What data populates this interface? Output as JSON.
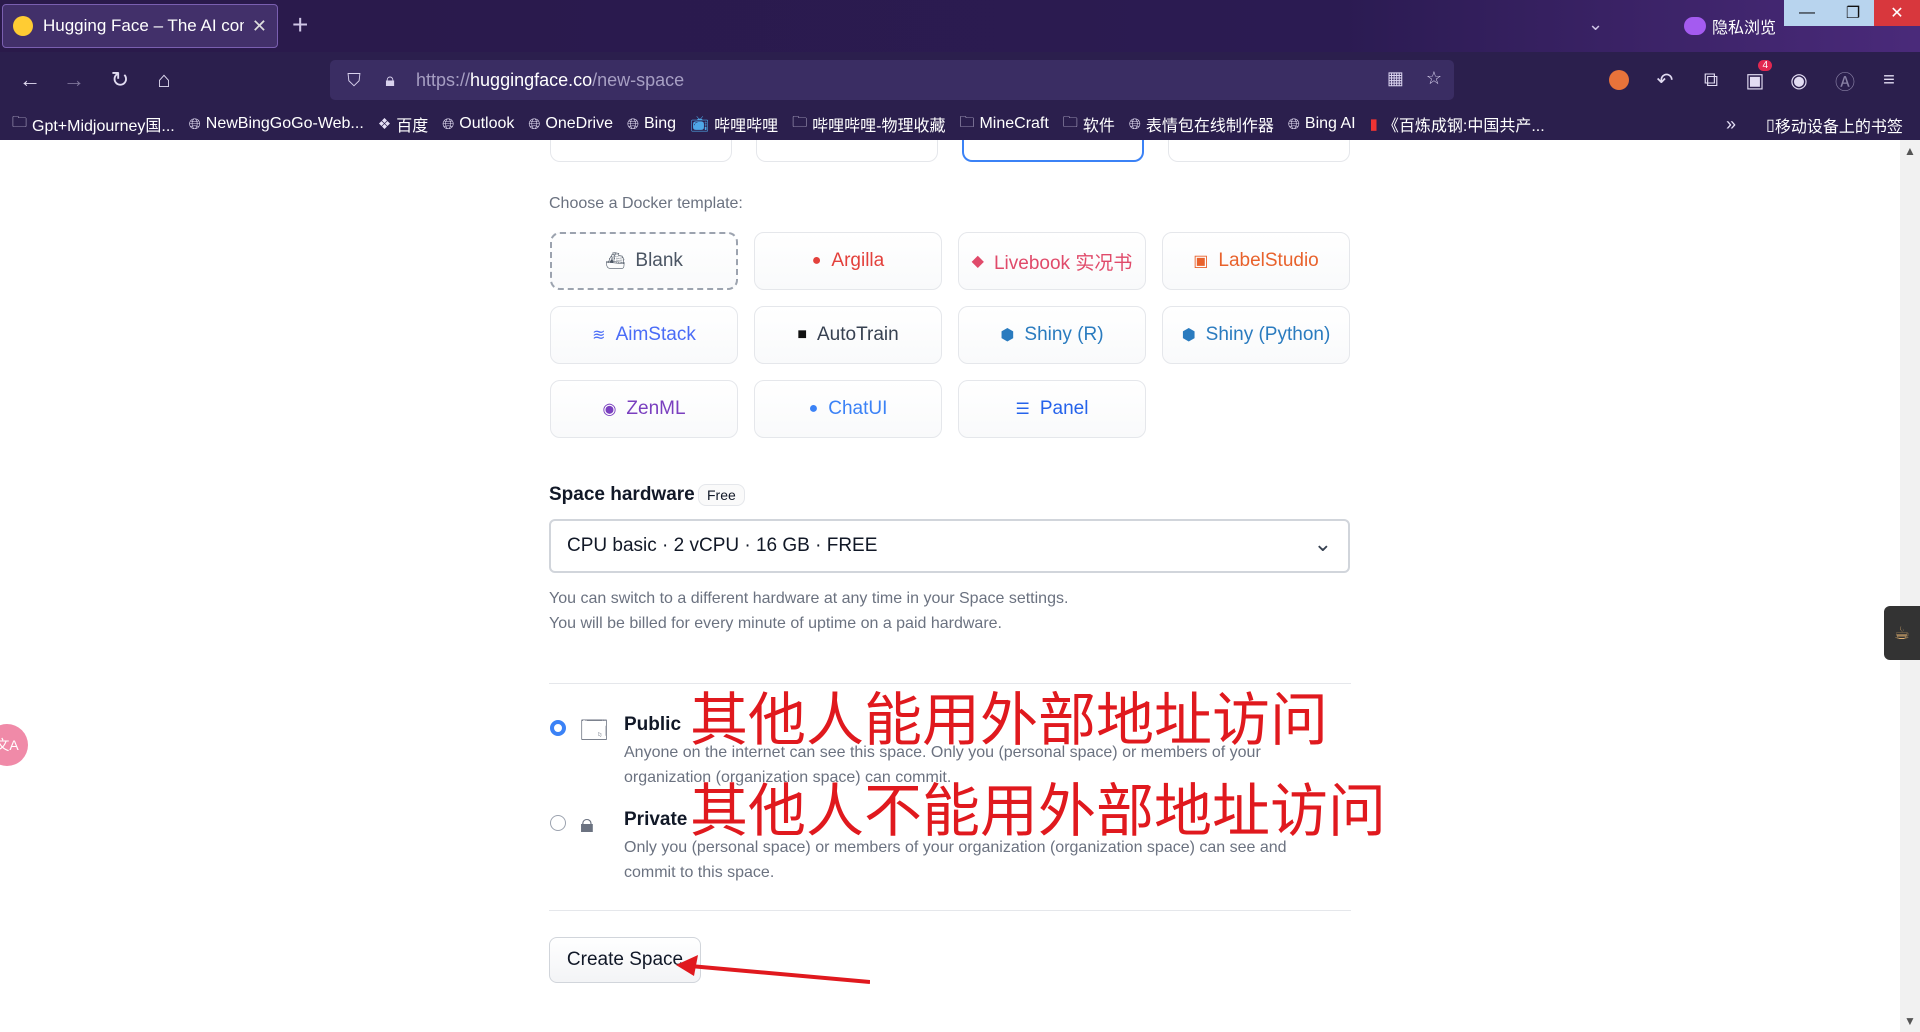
{
  "browser": {
    "tab_title": "Hugging Face – The AI comm",
    "new_tab": "+",
    "private_label": "隐私浏览",
    "url_scheme": "https://",
    "url_host": "huggingface.co",
    "url_path": "/new-space",
    "extension_badge": "4",
    "bookmarks": [
      {
        "label": "Gpt+Midjourney国...",
        "icon": "folder-icon"
      },
      {
        "label": "NewBingGoGo-Web...",
        "icon": "globe-icon"
      },
      {
        "label": "百度",
        "icon": "baidu-icon"
      },
      {
        "label": "Outlook",
        "icon": "globe-icon"
      },
      {
        "label": "OneDrive",
        "icon": "globe-icon"
      },
      {
        "label": "Bing",
        "icon": "globe-icon"
      },
      {
        "label": "哔哩哔哩",
        "icon": "bilibili-icon"
      },
      {
        "label": "哔哩哔哩-物理收藏",
        "icon": "folder-icon"
      },
      {
        "label": "MineCraft",
        "icon": "folder-icon"
      },
      {
        "label": "软件",
        "icon": "folder-icon"
      },
      {
        "label": "表情包在线制作器",
        "icon": "globe-icon"
      },
      {
        "label": "Bing AI",
        "icon": "globe-icon"
      },
      {
        "label": "《百炼成钢:中国共产...",
        "icon": "book-icon"
      }
    ],
    "mobile_bookmarks": "移动设备上的书签"
  },
  "page": {
    "docker_label": "Choose a Docker template:",
    "templates": [
      {
        "label": "Blank",
        "color": "#4b5563"
      },
      {
        "label": "Argilla",
        "color": "#e3413c"
      },
      {
        "label": "Livebook 实况书",
        "color": "#e04a6a"
      },
      {
        "label": "LabelStudio",
        "color": "#e8622c"
      },
      {
        "label": "AimStack",
        "color": "#4a6cf7"
      },
      {
        "label": "AutoTrain",
        "color": "#374151"
      },
      {
        "label": "Shiny (R)",
        "color": "#2a7bbf"
      },
      {
        "label": "Shiny (Python)",
        "color": "#2a7bbf"
      },
      {
        "label": "ZenML",
        "color": "#7a3fbf"
      },
      {
        "label": "ChatUI",
        "color": "#3b82f6"
      },
      {
        "label": "Panel",
        "color": "#2563eb"
      }
    ],
    "hardware": {
      "label": "Space hardware",
      "badge": "Free",
      "selected": "CPU basic · 2 vCPU · 16 GB · FREE",
      "help_1": "You can switch to a different hardware at any time in your Space settings.",
      "help_2": "You will be billed for every minute of uptime on a paid hardware."
    },
    "visibility": {
      "public_title": "Public",
      "public_desc": "Anyone on the internet can see this space. Only you (personal space) or members of your organization (organization space) can commit.",
      "private_title": "Private",
      "private_desc": "Only you (personal space) or members of your organization (organization space) can see and commit to this space."
    },
    "create_button": "Create Space",
    "annotations": {
      "public_note": "其他人能用外部地址访问",
      "private_note": "其他人不能用外部地址访问",
      "color": "#e0191e"
    }
  }
}
